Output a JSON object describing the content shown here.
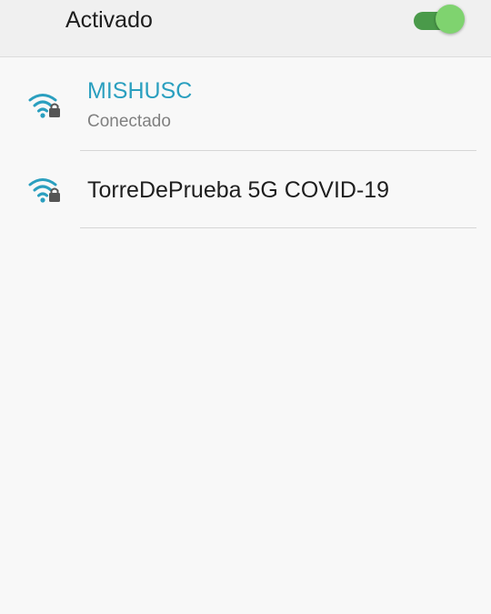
{
  "wifi_toggle": {
    "label": "Activado",
    "state": "on",
    "track_color": "#4a9a4a",
    "thumb_color": "#7fd36f"
  },
  "networks": [
    {
      "name": "MISHUSC",
      "status": "Conectado",
      "icon": "wifi-locked-icon",
      "name_color": "#2a9fbf"
    },
    {
      "name": "TorreDePrueba 5G COVID-19",
      "status": "",
      "icon": "wifi-locked-icon",
      "name_color": "#1e1e1e"
    }
  ],
  "colors": {
    "accent": "#2a9fbf",
    "background": "#f8f8f8",
    "header_background": "#f0f0f0"
  }
}
